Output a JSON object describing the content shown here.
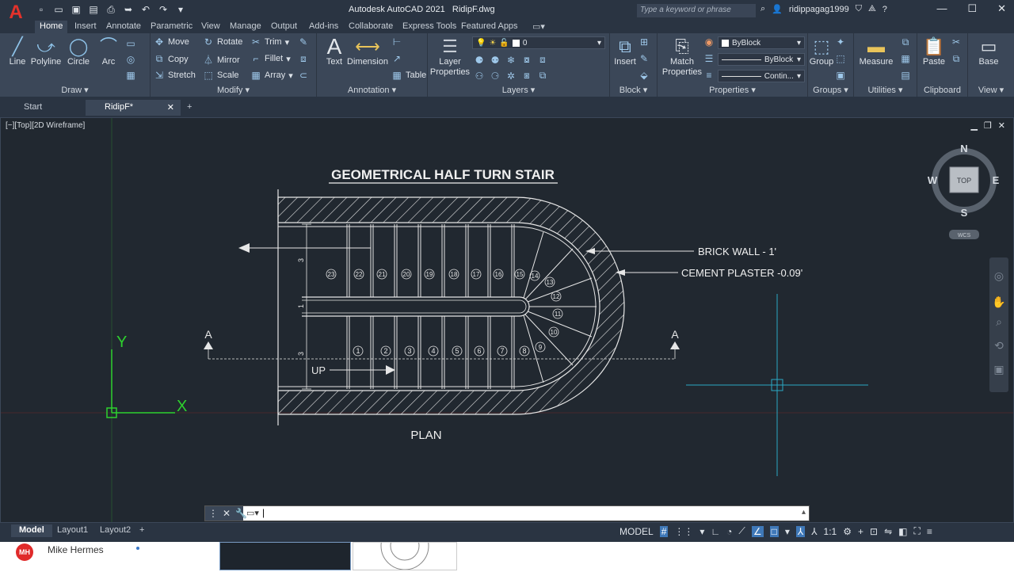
{
  "app": {
    "logo": "A",
    "title": "Autodesk AutoCAD 2021",
    "file": "RidipF.dwg",
    "search_placeholder": "Type a keyword or phrase",
    "user": "ridippagag1999",
    "qat_icons": [
      "new-icon",
      "open-icon",
      "save-icon",
      "save-as-icon",
      "plot-icon",
      "undo-icon",
      "redo-icon",
      "more-icon"
    ]
  },
  "ribbon_tabs": [
    "Home",
    "Insert",
    "Annotate",
    "Parametric",
    "View",
    "Manage",
    "Output",
    "Add-ins",
    "Collaborate",
    "Express Tools",
    "Featured Apps"
  ],
  "ribbon": {
    "draw": {
      "title": "Draw",
      "line": "Line",
      "polyline": "Polyline",
      "circle": "Circle",
      "arc": "Arc"
    },
    "modify": {
      "title": "Modify",
      "move": "Move",
      "rotate": "Rotate",
      "trim": "Trim",
      "copy": "Copy",
      "mirror": "Mirror",
      "fillet": "Fillet",
      "stretch": "Stretch",
      "scale": "Scale",
      "array": "Array"
    },
    "annotation": {
      "title": "Annotation",
      "text": "Text",
      "dimension": "Dimension",
      "table": "Table"
    },
    "layers": {
      "title": "Layers",
      "layer_properties_1": "Layer",
      "layer_properties_2": "Properties",
      "current_layer": "0"
    },
    "block": {
      "title": "Block",
      "insert": "Insert"
    },
    "properties": {
      "title": "Properties",
      "match_1": "Match",
      "match_2": "Properties",
      "color": "ByBlock",
      "lineweight": "ByBlock",
      "linetype": "Contin..."
    },
    "groups": {
      "title": "Groups",
      "group": "Group"
    },
    "utilities": {
      "title": "Utilities",
      "measure": "Measure"
    },
    "clipboard": {
      "title": "Clipboard",
      "paste": "Paste"
    },
    "view": {
      "title": "View",
      "base": "Base"
    }
  },
  "doc_tabs": [
    "Start",
    "RidipF*"
  ],
  "viewport": {
    "label": "[−][Top][2D Wireframe]",
    "compass": {
      "n": "N",
      "s": "S",
      "e": "E",
      "w": "W",
      "top": "TOP",
      "wcs": "WCS"
    }
  },
  "drawing": {
    "title": "GEOMETRICAL HALF TURN STAIR",
    "plan_label": "PLAN",
    "up_label": "UP",
    "brick_wall": "BRICK WALL - 1'",
    "cement_plaster": "CEMENT PLASTER -0.09'",
    "section_mark": "A",
    "ucs_x": "X",
    "ucs_y": "Y",
    "dim_3": "3",
    "dim_1": "1",
    "lower_steps": [
      "1",
      "2",
      "3",
      "4",
      "5",
      "6",
      "7",
      "8"
    ],
    "winder_steps": [
      "9",
      "10",
      "11",
      "12",
      "13",
      "14"
    ],
    "upper_steps": [
      "15",
      "16",
      "17",
      "18",
      "19",
      "20",
      "21",
      "22",
      "23"
    ]
  },
  "layout_tabs": [
    "Model",
    "Layout1",
    "Layout2"
  ],
  "status": {
    "model": "MODEL",
    "scale": "1:1"
  },
  "taskbar": {
    "avatar": "MH",
    "name": "Mike Hermes"
  }
}
